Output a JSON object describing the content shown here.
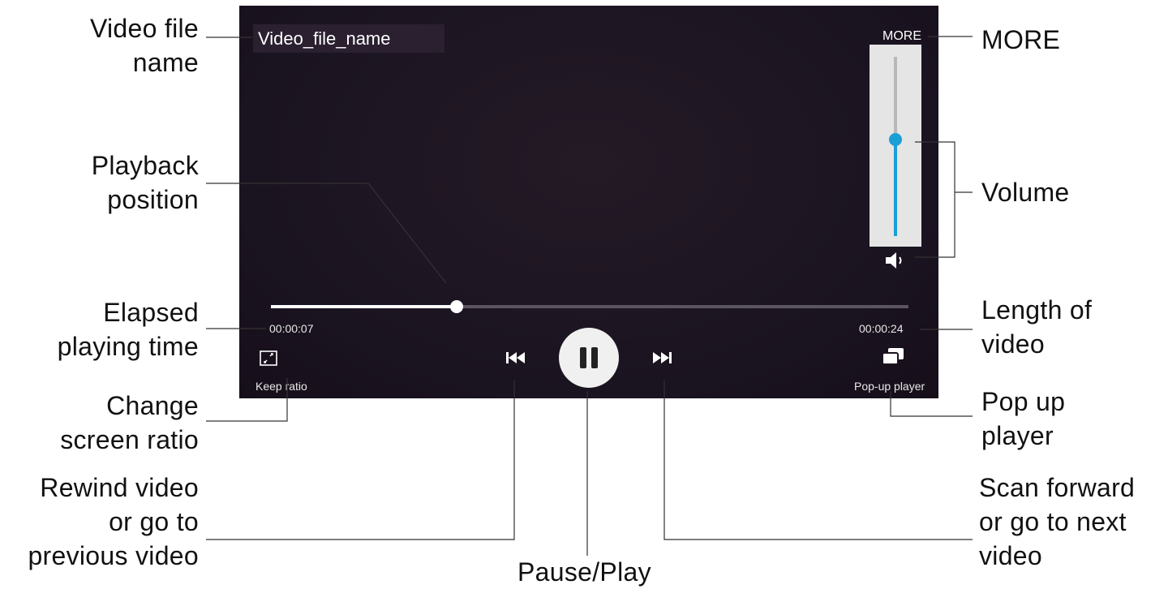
{
  "player": {
    "file_name": "Video_file_name",
    "more_label": "MORE",
    "elapsed_time": "00:00:07",
    "total_time": "00:00:24",
    "progress_fraction": 0.2917,
    "volume_fraction": 0.54,
    "keep_ratio_label": "Keep ratio",
    "popup_label": "Pop-up player",
    "accent_color": "#1a9fd6"
  },
  "callouts": {
    "video_file_name": "Video file\nname",
    "playback_position": "Playback\nposition",
    "elapsed_playing_time": "Elapsed\nplaying time",
    "change_screen_ratio": "Change\nscreen ratio",
    "rewind_video": "Rewind video\nor go to\nprevious video",
    "pause_play": "Pause/Play",
    "more": "MORE",
    "volume": "Volume",
    "length_of_video": "Length of\nvideo",
    "pop_up_player": "Pop up\nplayer",
    "scan_forward": "Scan forward\nor go to next\nvideo"
  },
  "icons": {
    "speaker": "speaker-icon",
    "keep_ratio": "expand-icon",
    "popup": "popup-window-icon",
    "previous": "skip-previous-icon",
    "next": "skip-next-icon",
    "pause": "pause-icon"
  }
}
